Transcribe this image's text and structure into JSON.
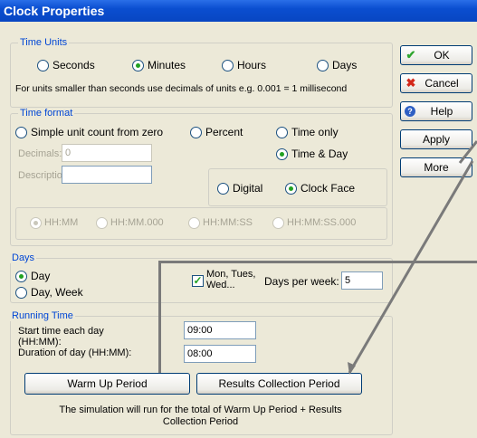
{
  "window": {
    "title": "Clock Properties"
  },
  "time_units": {
    "label": "Time Units",
    "options": [
      "Seconds",
      "Minutes",
      "Hours",
      "Days"
    ],
    "selected": "Minutes",
    "note": "For units smaller than seconds use decimals of units e.g. 0.001 = 1 millisecond"
  },
  "time_format": {
    "label": "Time format",
    "opt_simple": "Simple unit count from zero",
    "opt_percent": "Percent",
    "opt_time_only": "Time only",
    "opt_time_day": "Time & Day",
    "selected": "Time & Day",
    "decimals_label": "Decimals:",
    "decimals_value": "0",
    "description_label": "Description:",
    "description_value": "",
    "opt_digital": "Digital",
    "opt_clock_face": "Clock Face",
    "clock_selected": "Clock Face",
    "format_options": [
      "HH:MM",
      "HH:MM.000",
      "HH:MM:SS",
      "HH:MM:SS.000"
    ],
    "format_selected": "HH:MM"
  },
  "days": {
    "label": "Days",
    "opt_day": "Day",
    "opt_day_week": "Day, Week",
    "selected": "Day",
    "mon_tues_wed_line1": "Mon, Tues,",
    "mon_tues_wed_line2": "Wed...",
    "mon_checked": true,
    "days_per_week_label": "Days per week:",
    "days_per_week_value": "5"
  },
  "running_time": {
    "label": "Running Time",
    "start_label_1": "Start time each day",
    "start_label_2": "(HH:MM):",
    "start_value": "09:00",
    "duration_label": "Duration of day (HH:MM):",
    "duration_value": "08:00",
    "warm_up_button": "Warm Up Period",
    "results_button": "Results Collection Period",
    "note_line1": "The simulation will run for the total of Warm Up Period + Results",
    "note_line2": "Collection Period"
  },
  "buttons": {
    "ok": "OK",
    "cancel": "Cancel",
    "help": "Help",
    "apply": "Apply",
    "more": "More"
  },
  "colors": {
    "accent": "#0046d5",
    "radio_dot": "#21a121",
    "title_bar": "#0a4ed0"
  }
}
